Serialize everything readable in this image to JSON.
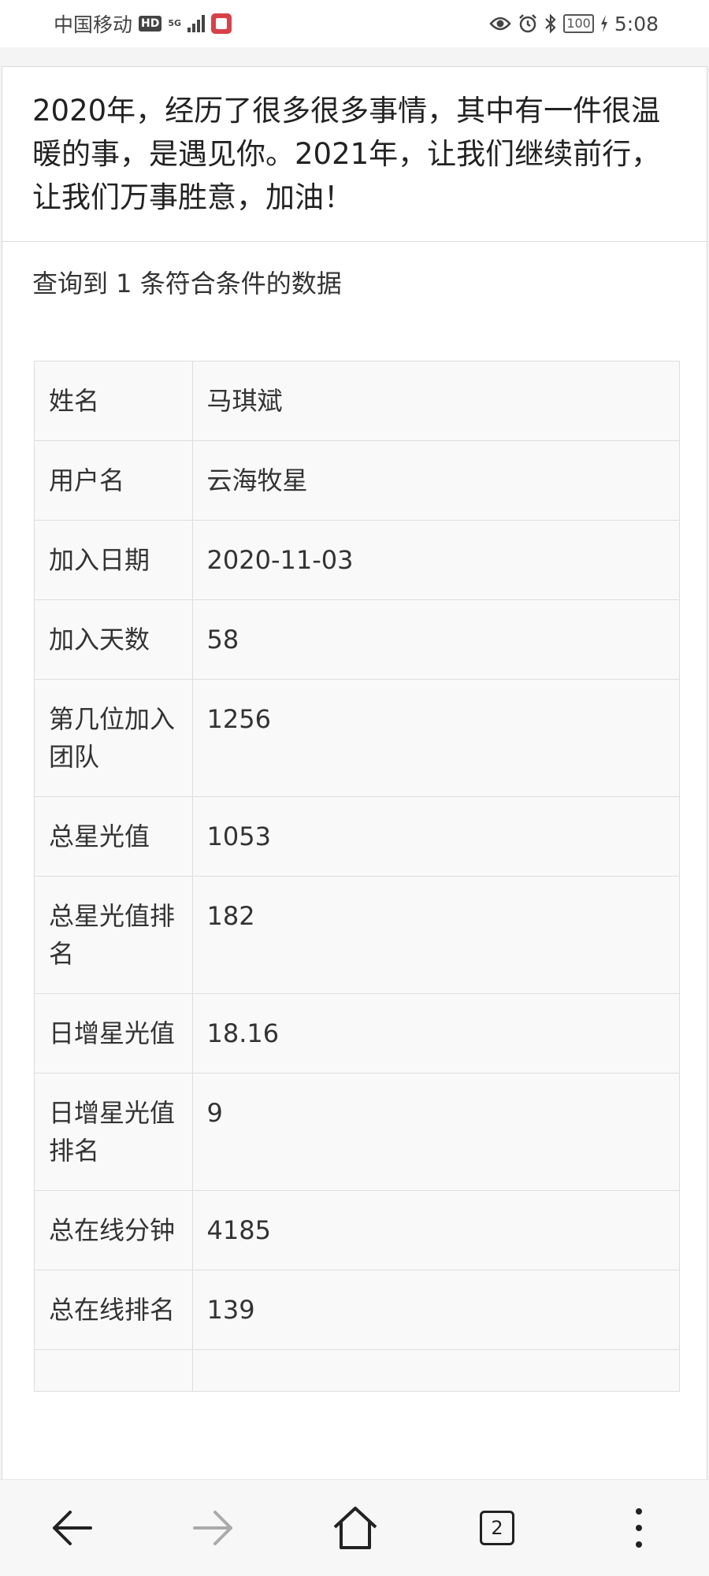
{
  "status_bar": {
    "carrier": "中国移动",
    "hd_badge": "HD",
    "network": "5G",
    "battery": "100",
    "time": "5:08"
  },
  "header": {
    "message": "2020年，经历了很多很多事情，其中有一件很温暖的事，是遇见你。2021年，让我们继续前行，让我们万事胜意，加油！"
  },
  "result": {
    "text": "查询到 1 条符合条件的数据"
  },
  "table": {
    "rows": [
      {
        "label": "姓名",
        "value": "马琪斌"
      },
      {
        "label": "用户名",
        "value": "云海牧星"
      },
      {
        "label": "加入日期",
        "value": "2020-11-03"
      },
      {
        "label": "加入天数",
        "value": "58"
      },
      {
        "label": "第几位加入团队",
        "value": "1256"
      },
      {
        "label": "总星光值",
        "value": "1053"
      },
      {
        "label": "总星光值排名",
        "value": "182"
      },
      {
        "label": "日增星光值",
        "value": "18.16"
      },
      {
        "label": "日增星光值排名",
        "value": "9"
      },
      {
        "label": "总在线分钟",
        "value": "4185"
      },
      {
        "label": "总在线排名",
        "value": "139"
      },
      {
        "label": "",
        "value": ""
      }
    ]
  },
  "nav": {
    "tabs_count": "2",
    "icons": [
      "back-arrow-icon",
      "forward-arrow-icon",
      "home-icon",
      "tabs-icon",
      "more-vertical-icon"
    ]
  }
}
